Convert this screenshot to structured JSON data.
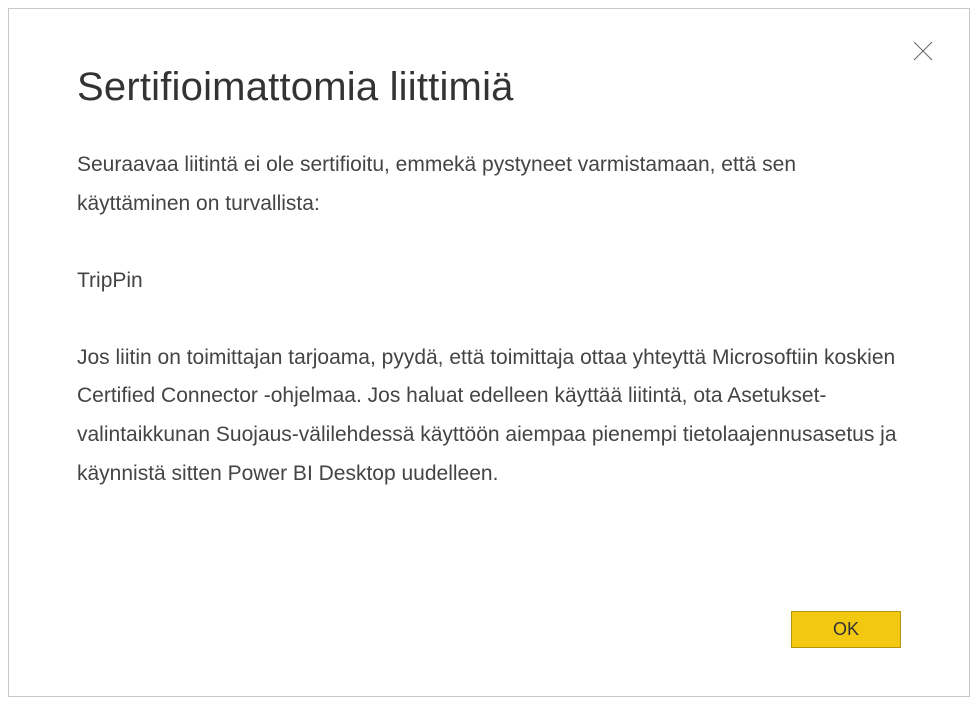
{
  "dialog": {
    "title": "Sertifioimattomia liittimiä",
    "intro": "Seuraavaa liitintä ei ole sertifioitu, emmekä pystyneet varmistamaan, että sen käyttäminen on turvallista:",
    "connector_name": "TripPin",
    "instruction": "Jos liitin on toimittajan tarjoama, pyydä, että toimittaja ottaa yhteyttä Microsoftiin koskien Certified Connector -ohjelmaa. Jos haluat edelleen käyttää liitintä, ota Asetukset-valintaikkunan Suojaus-välilehdessä käyttöön aiempaa pienempi tietolaajennusasetus ja käynnistä sitten Power BI Desktop uudelleen.",
    "ok_label": "OK"
  },
  "colors": {
    "accent": "#f2c811",
    "border": "#c8c8c8",
    "text_primary": "#333333",
    "text_body": "#444444"
  }
}
